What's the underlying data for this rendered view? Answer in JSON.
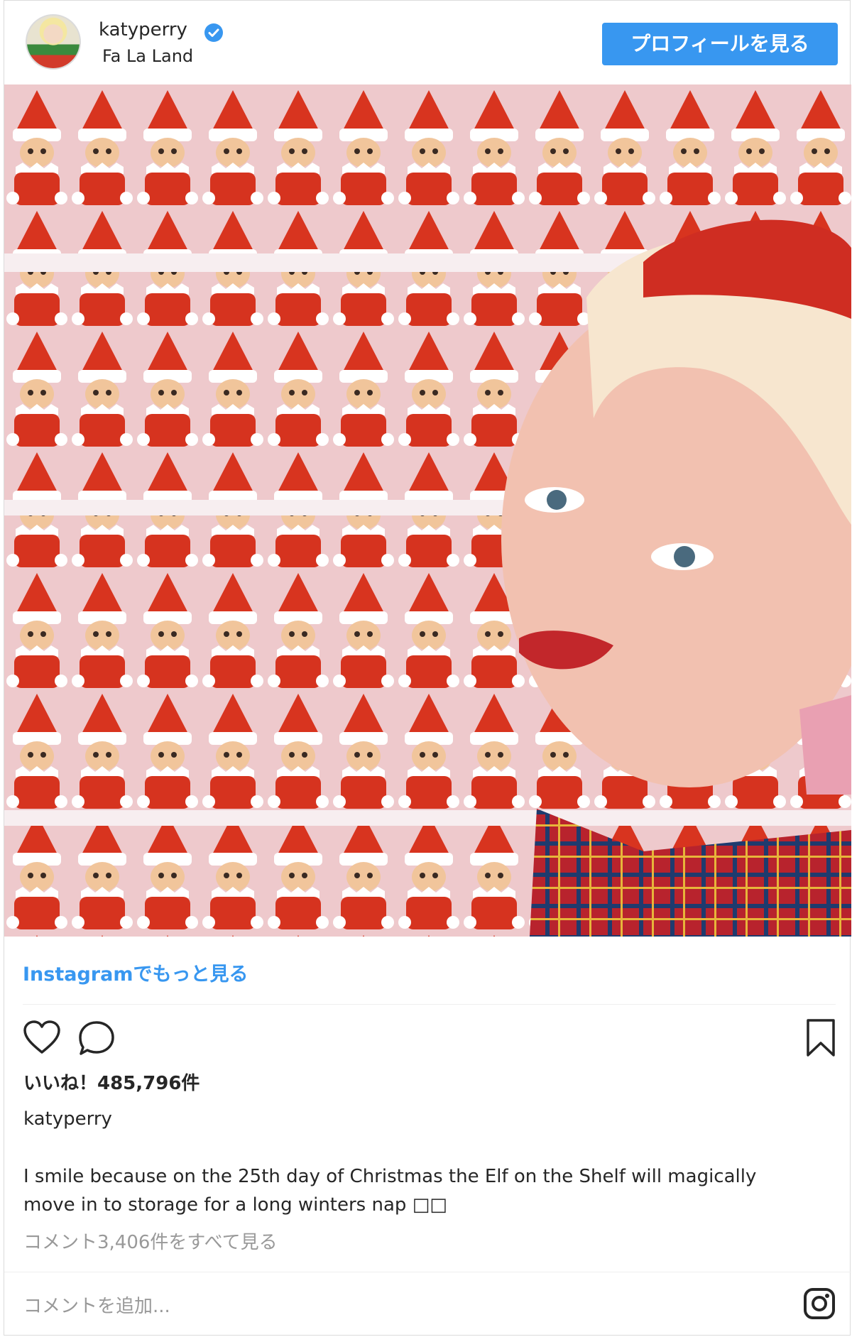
{
  "header": {
    "username": "katyperry",
    "location": "Fa La Land",
    "profile_button": "プロフィールを見る"
  },
  "links": {
    "more_on_instagram": "Instagramでもっと見る"
  },
  "actions": {
    "like_icon": "heart-icon",
    "comment_icon": "comment-icon",
    "save_icon": "bookmark-icon"
  },
  "post": {
    "likes": "いいね！485,796件",
    "caption_username": "katyperry",
    "caption_line1": "I smile because on the 25th day of Christmas the Elf on the Shelf will magically",
    "caption_line2": "move in to storage for a long winters nap ",
    "caption_emoji": "□□",
    "view_comments": "コメント3,406件をすべて見る"
  },
  "comment_box": {
    "placeholder": "コメントを追加...",
    "icon": "instagram-icon"
  },
  "colors": {
    "accent": "#3897f0",
    "text": "#262626",
    "muted": "#999999",
    "border": "#dbdbdb"
  }
}
